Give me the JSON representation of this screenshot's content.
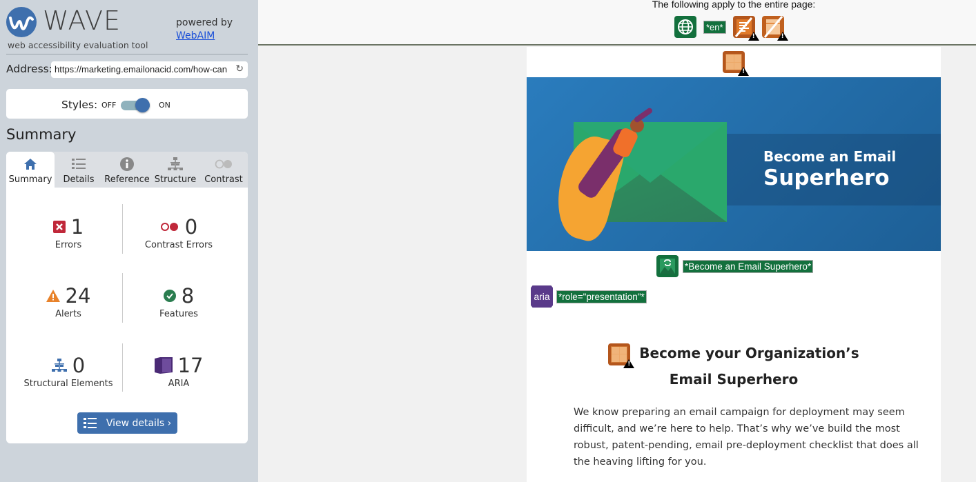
{
  "app": {
    "logo_word": "WAVE",
    "logo_subtitle": "web accessibility evaluation tool",
    "powered_by": "powered by",
    "powered_link": "WebAIM"
  },
  "address": {
    "label": "Address:",
    "value": "https://marketing.emailonacid.com/how-can",
    "reload_icon": "reload-icon"
  },
  "styles": {
    "label": "Styles:",
    "off_label": "OFF",
    "on_label": "ON",
    "state": "on"
  },
  "summary": {
    "title": "Summary",
    "tabs": [
      {
        "label": "Summary",
        "icon": "home-icon",
        "active": true
      },
      {
        "label": "Details",
        "icon": "list-icon",
        "active": false
      },
      {
        "label": "Reference",
        "icon": "info-icon",
        "active": false
      },
      {
        "label": "Structure",
        "icon": "hierarchy-icon",
        "active": false
      },
      {
        "label": "Contrast",
        "icon": "contrast-icon",
        "active": false
      }
    ],
    "stats": [
      {
        "label": "Errors",
        "value": "1",
        "icon": "error-icon",
        "color": "#c0283a"
      },
      {
        "label": "Contrast Errors",
        "value": "0",
        "icon": "contrast-error-icon",
        "color": "#c0283a"
      },
      {
        "label": "Alerts",
        "value": "24",
        "icon": "alert-icon",
        "color": "#e8822a"
      },
      {
        "label": "Features",
        "value": "8",
        "icon": "feature-icon",
        "color": "#2a7d4f"
      },
      {
        "label": "Structural Elements",
        "value": "0",
        "icon": "structure-icon",
        "color": "#3e6fad"
      },
      {
        "label": "ARIA",
        "value": "17",
        "icon": "aria-icon",
        "color": "#4a2a75"
      }
    ],
    "view_details": "View details ›"
  },
  "main": {
    "apply_text": "The following apply to the entire page:",
    "lang_tag": "*en*",
    "banner": {
      "line1": "Become an Email",
      "line2": "Superhero"
    },
    "alt_tag": "*Become an Email Superhero*",
    "aria_icon_text": "aria",
    "aria_tag": "*role=\"presentation\"*",
    "heading_line1": "Become your Organization’s",
    "heading_line2": "Email Superhero",
    "paragraph": "We know preparing an email campaign for deployment may seem difficult, and we’re here to help. That’s why we’ve build the most robust, patent-pending, email pre-deployment checklist that does all the heaving lifting for you."
  },
  "colors": {
    "sidebar_bg": "#cdd4db",
    "accent": "#3e6fad",
    "wave_green": "#13703d"
  }
}
